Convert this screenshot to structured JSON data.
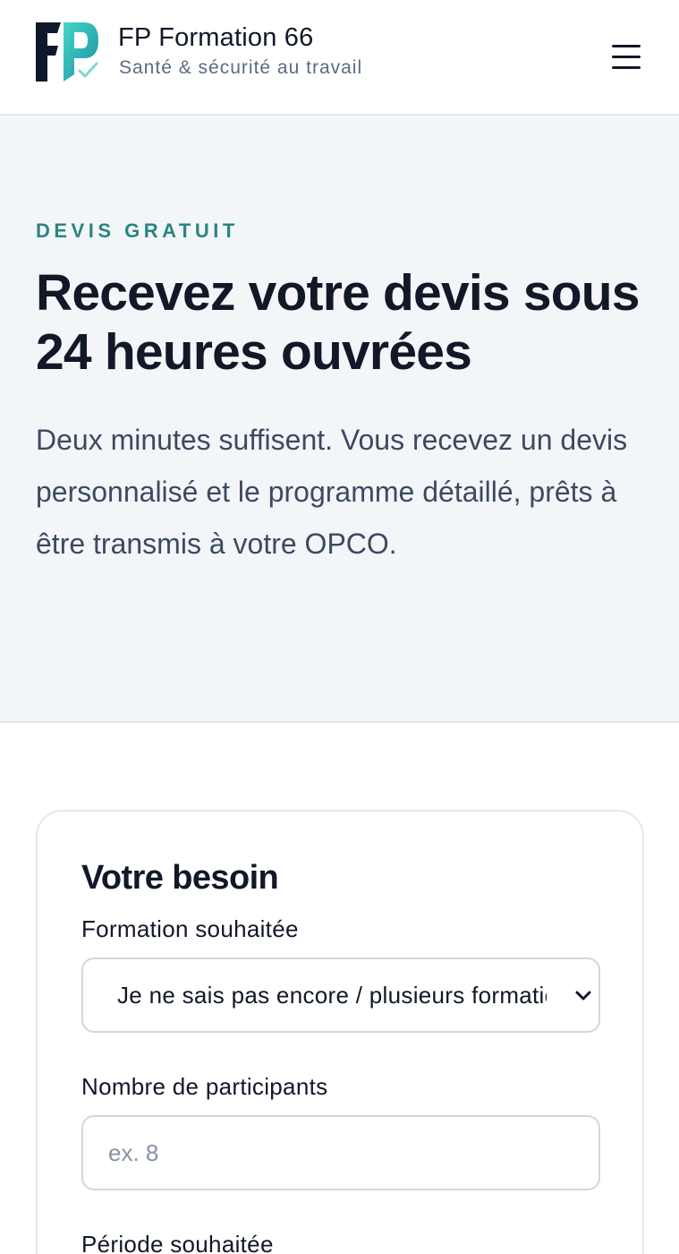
{
  "header": {
    "brand_name": "FP Formation 66",
    "tagline": "Santé & sécurité au travail",
    "logo_text": "FP",
    "menu_icon": "hamburger-menu-icon"
  },
  "hero": {
    "eyebrow": "DEVIS GRATUIT",
    "title": "Recevez votre devis sous 24 heures ouvrées",
    "description": "Deux minutes suffisent. Vous recevez un devis personnalisé et le programme détaillé, prêts à être transmis à votre OPCO."
  },
  "form": {
    "section_title": "Votre besoin",
    "formation_label": "Formation souhaitée",
    "formation_value": "Je ne sais pas encore / plusieurs formations",
    "participants_label": "Nombre de participants",
    "participants_placeholder": "ex. 8",
    "periode_label": "Période souhaitée"
  },
  "colors": {
    "accent_teal": "#2a8580",
    "logo_dark": "#0f172a",
    "logo_gradient_start": "#3fd0c2",
    "logo_gradient_end": "#1f9aa8",
    "hero_bg": "#f3f6f9"
  }
}
